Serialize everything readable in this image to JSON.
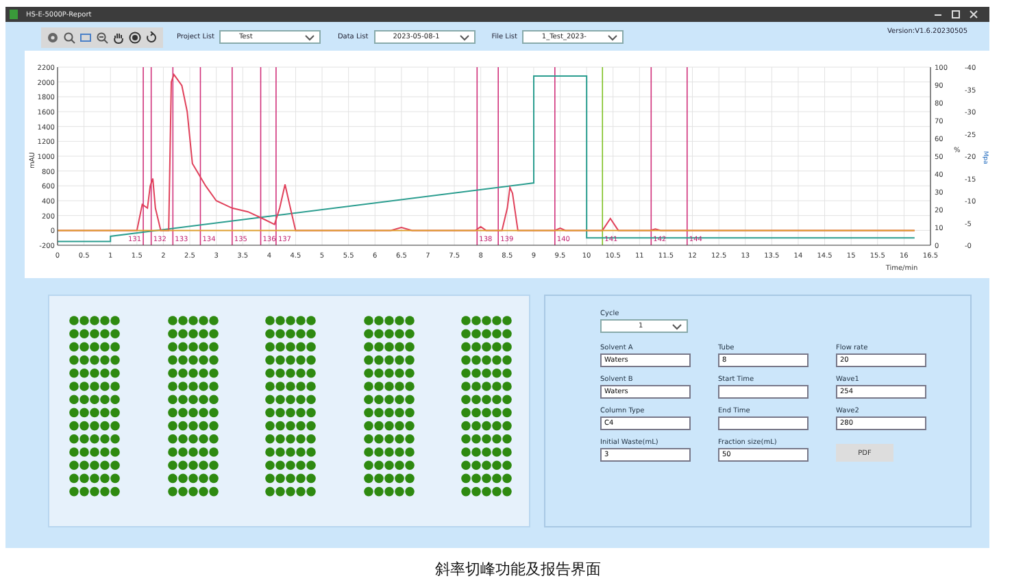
{
  "window": {
    "title": "HS-E-5000P-Report",
    "version": "Version:V1.6.20230505"
  },
  "toolbar": {
    "selectors": [
      {
        "label": "Project List",
        "value": "Test"
      },
      {
        "label": "Data List",
        "value": "2023-05-08-1"
      },
      {
        "label": "File List",
        "value": "1_Test_2023-"
      }
    ]
  },
  "chart": {
    "right_axis_1": {
      "label": "%",
      "ticks": [
        "100",
        "90",
        "80",
        "70",
        "60",
        "50",
        "40",
        "30",
        "20",
        "10",
        "0"
      ]
    },
    "right_axis_2": {
      "label": "Mpa",
      "ticks": [
        "-40",
        "-35",
        "-30",
        "-25",
        "-20",
        "-15",
        "-10",
        "-5",
        "-0"
      ]
    },
    "chart_data": {
      "type": "line",
      "xlabel": "Time/min",
      "ylabel": "mAU",
      "xlim": [
        0,
        16.5
      ],
      "ylim": [
        -200,
        2200
      ],
      "xticks": [
        0,
        0.5,
        1,
        1.5,
        2,
        2.5,
        3,
        3.5,
        4,
        4.5,
        5,
        5.5,
        6,
        6.5,
        7,
        7.5,
        8,
        8.5,
        9,
        9.5,
        10,
        10.5,
        11,
        11.5,
        12,
        12.5,
        13,
        13.5,
        14,
        14.5,
        15,
        15.5,
        16,
        16.5
      ],
      "yticks": [
        -200,
        0,
        200,
        400,
        600,
        800,
        1000,
        1200,
        1400,
        1600,
        1800,
        2000,
        2200
      ],
      "series": [
        {
          "color": "#2a9d8f",
          "x": [
            0,
            1,
            1,
            9,
            9,
            10,
            10,
            16.2
          ],
          "values": [
            -150,
            -150,
            -80,
            640,
            2080,
            2080,
            -100,
            -100
          ]
        },
        {
          "color": "#e0405a",
          "x": [
            0,
            1.5,
            1.6,
            1.7,
            1.75,
            1.8,
            1.85,
            1.95,
            2.1,
            2.15,
            2.2,
            2.35,
            2.45,
            2.55,
            2.8,
            3.0,
            3.3,
            3.6,
            3.9,
            4.1,
            4.2,
            4.3,
            4.4,
            4.5,
            6.3,
            6.5,
            6.7,
            7.9,
            8.0,
            8.1,
            8.4,
            8.5,
            8.55,
            8.6,
            8.7,
            9.4,
            9.5,
            9.6,
            10.3,
            10.45,
            10.6,
            11.2,
            11.3,
            11.4,
            16.2
          ],
          "values": [
            0,
            0,
            350,
            300,
            600,
            700,
            300,
            0,
            0,
            2000,
            2100,
            1950,
            1600,
            900,
            600,
            400,
            300,
            250,
            150,
            80,
            300,
            620,
            300,
            0,
            0,
            40,
            0,
            0,
            50,
            0,
            0,
            300,
            580,
            500,
            0,
            0,
            30,
            0,
            0,
            160,
            0,
            0,
            20,
            0,
            0
          ]
        },
        {
          "color": "#e0a030",
          "x": [
            0,
            16.2
          ],
          "values": [
            0,
            0
          ]
        }
      ],
      "grid": true,
      "ref_lines": [
        {
          "axis": "x",
          "value": 1.62,
          "color": "#d0307a"
        },
        {
          "axis": "x",
          "value": 1.77,
          "color": "#d0307a"
        },
        {
          "axis": "x",
          "value": 2.18,
          "color": "#d0307a"
        },
        {
          "axis": "x",
          "value": 2.7,
          "color": "#d0307a"
        },
        {
          "axis": "x",
          "value": 3.3,
          "color": "#d0307a"
        },
        {
          "axis": "x",
          "value": 3.84,
          "color": "#d0307a"
        },
        {
          "axis": "x",
          "value": 4.13,
          "color": "#d0307a"
        },
        {
          "axis": "x",
          "value": 7.93,
          "color": "#d0307a"
        },
        {
          "axis": "x",
          "value": 8.33,
          "color": "#d0307a"
        },
        {
          "axis": "x",
          "value": 9.4,
          "color": "#d0307a"
        },
        {
          "axis": "x",
          "value": 10.3,
          "color": "#7cc020"
        },
        {
          "axis": "x",
          "value": 11.22,
          "color": "#d0307a"
        },
        {
          "axis": "x",
          "value": 11.9,
          "color": "#d0307a"
        }
      ],
      "annotations": [
        "131",
        "132",
        "133",
        "134",
        "135",
        "136",
        "137",
        "138",
        "139",
        "140",
        "141",
        "142",
        "144"
      ]
    }
  },
  "form": {
    "cycle": {
      "label": "Cycle",
      "value": "1"
    },
    "fields": [
      {
        "label": "Solvent A",
        "value": "Waters"
      },
      {
        "label": "Tube",
        "value": "8"
      },
      {
        "label": "Flow rate",
        "value": "20"
      },
      {
        "label": "Solvent B",
        "value": "Waters"
      },
      {
        "label": "Start Time"
      },
      {
        "label": "Wave1",
        "value": "254"
      },
      {
        "label": "Column Type",
        "value": "C4"
      },
      {
        "label": "End Time"
      },
      {
        "label": "Wave2",
        "value": "280"
      },
      {
        "label": "Initial Waste(mL)",
        "value": "3"
      },
      {
        "label": "Fraction size(mL)",
        "value": "50"
      }
    ],
    "button": "PDF"
  },
  "caption": "斜率切峰功能及报告界面"
}
